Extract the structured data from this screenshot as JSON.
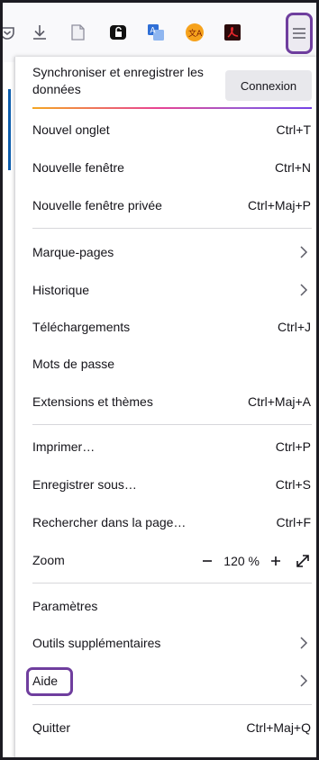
{
  "toolbar": {
    "icons": [
      "pocket-icon",
      "download-icon",
      "page-icon",
      "lock-shield-icon",
      "translate-icon",
      "language-badge-icon",
      "pdf-icon",
      "hamburger-menu-icon"
    ]
  },
  "sync": {
    "text": "Synchroniser et enregistrer les données",
    "button_label": "Connexion"
  },
  "menu": {
    "new_tab": {
      "label": "Nouvel onglet",
      "shortcut": "Ctrl+T"
    },
    "new_window": {
      "label": "Nouvelle fenêtre",
      "shortcut": "Ctrl+N"
    },
    "private_window": {
      "label": "Nouvelle fenêtre privée",
      "shortcut": "Ctrl+Maj+P"
    },
    "bookmarks": {
      "label": "Marque-pages"
    },
    "history": {
      "label": "Historique"
    },
    "downloads": {
      "label": "Téléchargements",
      "shortcut": "Ctrl+J"
    },
    "passwords": {
      "label": "Mots de passe"
    },
    "addons": {
      "label": "Extensions et thèmes",
      "shortcut": "Ctrl+Maj+A"
    },
    "print": {
      "label": "Imprimer…",
      "shortcut": "Ctrl+P"
    },
    "save_as": {
      "label": "Enregistrer sous…",
      "shortcut": "Ctrl+S"
    },
    "find": {
      "label": "Rechercher dans la page…",
      "shortcut": "Ctrl+F"
    },
    "zoom": {
      "label": "Zoom",
      "value": "120 %",
      "minus": "−",
      "plus": "+"
    },
    "settings": {
      "label": "Paramètres"
    },
    "more_tools": {
      "label": "Outils supplémentaires"
    },
    "help": {
      "label": "Aide"
    },
    "quit": {
      "label": "Quitter",
      "shortcut": "Ctrl+Maj+Q"
    }
  },
  "colors": {
    "highlight": "#6f3e9e",
    "separator": "#d7d7db",
    "text": "#15141a"
  }
}
